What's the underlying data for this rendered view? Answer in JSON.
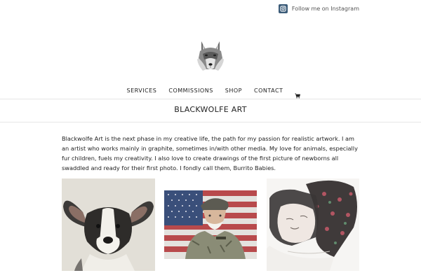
{
  "header": {
    "instagram_label": "Follow me on Instagram",
    "logo_icon": "wolf-logo",
    "brand_color": "#3b5b78"
  },
  "nav": {
    "items": [
      "SERVICES",
      "COMMISSIONS",
      "SHOP",
      "CONTACT"
    ],
    "cart_icon": "cart-icon"
  },
  "page": {
    "title": "BLACKWOLFE ART",
    "intro": "Blackwolfe Art is the next phase in my creative life, the path for my passion for realistic artwork. I am an artist who works mainly in graphite, sometimes in/with other media. My love for animals, especially fur children, fuels my creativity. I also love to create drawings of the first picture of newborns all swaddled and ready for their first photo. I fondly call them, Burrito Babies."
  },
  "gallery": {
    "items": [
      "dog-drawing",
      "soldier-flag-drawing",
      "swaddled-baby-drawing"
    ]
  }
}
